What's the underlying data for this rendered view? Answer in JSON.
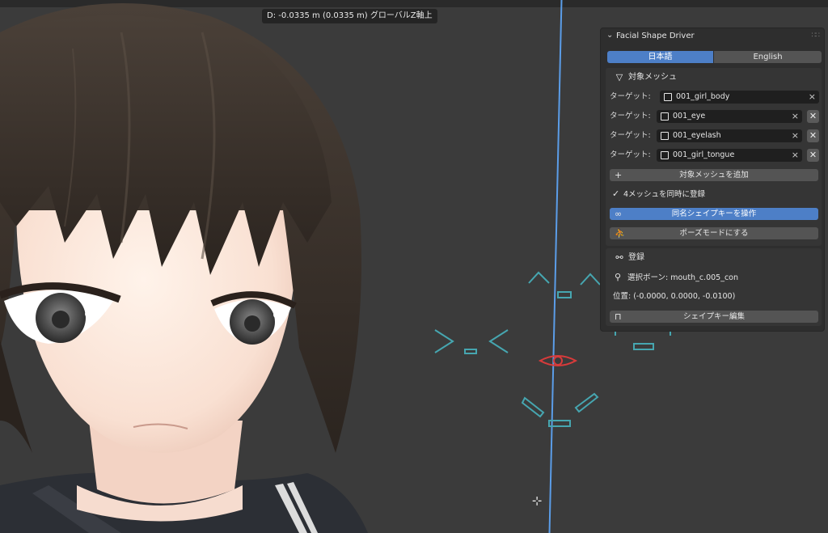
{
  "viewport": {
    "status_text": "D: -0.0335 m (0.0335 m) グローバルZ軸上"
  },
  "panel": {
    "title": "Facial Shape Driver",
    "lang_tabs": [
      "日本語",
      "English"
    ],
    "active_lang_index": 0,
    "target_section": {
      "title": "対象メッシュ",
      "targets": [
        {
          "label": "ターゲット:",
          "name": "001_girl_body",
          "removable": false
        },
        {
          "label": "ターゲット:",
          "name": "001_eye",
          "removable": true
        },
        {
          "label": "ターゲット:",
          "name": "001_eyelash",
          "removable": true
        },
        {
          "label": "ターゲット:",
          "name": "001_girl_tongue",
          "removable": true
        }
      ],
      "add_button": "対象メッシュを追加",
      "register_check": "4メッシュを同時に登録",
      "shapekey_button": "同名シェイプキーを操作",
      "pose_button": "ポーズモードにする"
    },
    "register_section": {
      "title": "登録",
      "selected_bone": "選択ボーン: mouth_c.005_con",
      "position": "位置: (-0.0000, 0.0000, -0.0100)",
      "edit_button": "シェイプキー編集"
    }
  },
  "colors": {
    "accent": "#4d7fc7",
    "rig_cyan": "#46a6b0",
    "rig_red": "#d83b3b",
    "axis_blue": "#5b9de8"
  },
  "icons": {
    "collapse": "chevron-down-icon",
    "mesh_section": "triangle-mesh-icon",
    "object": "object-icon",
    "clear": "close-icon",
    "add": "plus-icon",
    "check": "checkmark-icon",
    "link": "link-icon",
    "pose": "pose-icon",
    "register": "bone-link-icon",
    "bone": "bone-icon",
    "lock": "lock-icon",
    "cursor": "move-cursor-icon"
  }
}
